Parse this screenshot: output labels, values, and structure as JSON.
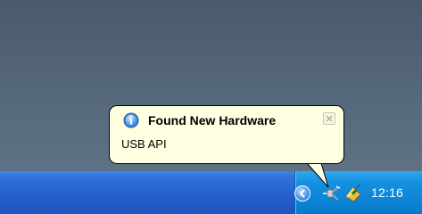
{
  "balloon": {
    "title": "Found New Hardware",
    "message": "USB API",
    "icon": "info-icon"
  },
  "tray": {
    "clock": "12:16",
    "icons": [
      "show-hidden-icons-chevron-icon",
      "safely-remove-hardware-icon",
      "network-drive-icon"
    ]
  },
  "colors": {
    "balloon_background": "#ffffe1",
    "taskbar_blue": "#2660cc",
    "tray_blue": "#0d83d6"
  }
}
